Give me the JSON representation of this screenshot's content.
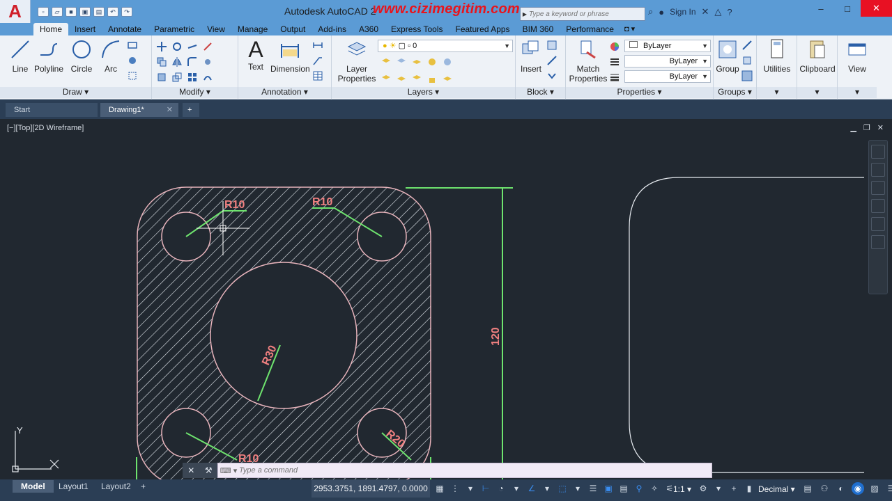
{
  "window": {
    "title": "Autodesk AutoCAD 2",
    "watermark": "www.cizimegitim.com",
    "search_placeholder": "Type a keyword or phrase",
    "sign_in": "Sign In"
  },
  "ribbon_tabs": [
    "Home",
    "Insert",
    "Annotate",
    "Parametric",
    "View",
    "Manage",
    "Output",
    "Add-ins",
    "A360",
    "Express Tools",
    "Featured Apps",
    "BIM 360",
    "Performance"
  ],
  "panels": {
    "draw": {
      "title": "Draw",
      "tools": [
        "Line",
        "Polyline",
        "Circle",
        "Arc"
      ]
    },
    "modify": {
      "title": "Modify"
    },
    "annotation": {
      "title": "Annotation",
      "text": "Text",
      "dimension": "Dimension"
    },
    "layers": {
      "title": "Layers",
      "layer_properties_l1": "Layer",
      "layer_properties_l2": "Properties",
      "current_layer": "0"
    },
    "block": {
      "title": "Block",
      "insert": "Insert"
    },
    "properties": {
      "title": "Properties",
      "match_l1": "Match",
      "match_l2": "Properties",
      "color": "ByLayer",
      "linetype": "ByLayer",
      "lineweight": "ByLayer"
    },
    "groups": {
      "title": "Groups",
      "group": "Group"
    },
    "utilities": "Utilities",
    "clipboard": "Clipboard",
    "view": "View"
  },
  "doc_tabs": {
    "start": "Start",
    "drawing": "Drawing1*",
    "plus": "+"
  },
  "viewport": {
    "label": "[−][Top][2D Wireframe]",
    "dims": {
      "r10_tl": "R10",
      "r10_tr": "R10",
      "r30": "R30",
      "r20": "R20",
      "r10_bl": "R10",
      "height": "120"
    },
    "ucs_y": "Y"
  },
  "command": {
    "placeholder": "Type a command"
  },
  "status": {
    "layouts": [
      "Model",
      "Layout1",
      "Layout2"
    ],
    "add_layout": "+",
    "coords": "2953.3751, 1891.4797, 0.0000",
    "scale": "1:1",
    "units": "Decimal"
  },
  "colors": {
    "accent": "#5b9bd5",
    "hatch": "#e8b4bc",
    "dim": "#6ee36e",
    "viewport_bg": "#212830"
  }
}
